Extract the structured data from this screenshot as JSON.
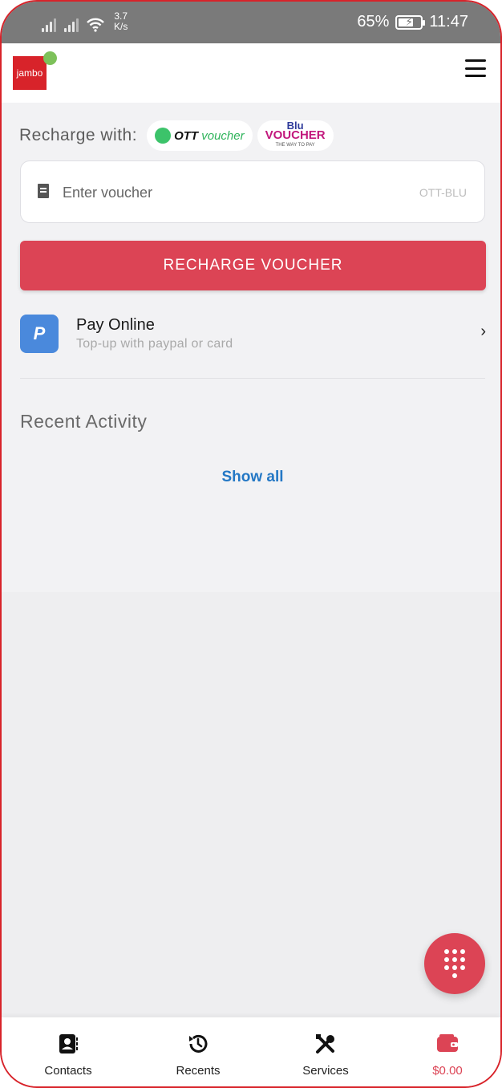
{
  "status_bar": {
    "speed_value": "3.7",
    "speed_unit": "K/s",
    "battery_percent": "65%",
    "time": "11:47"
  },
  "app": {
    "logo_text": "jambo",
    "menu_icon": "hamburger-icon"
  },
  "recharge": {
    "label": "Recharge with:",
    "providers": {
      "ott_brand": "OTT",
      "ott_suffix": "voucher",
      "blu_line1": "Blu",
      "blu_line2": "VOUCHER",
      "blu_tagline": "THE WAY TO PAY"
    },
    "voucher_placeholder": "Enter voucher",
    "voucher_value": "",
    "voucher_hint": "OTT-BLU",
    "button_label": "RECHARGE VOUCHER"
  },
  "pay_online": {
    "title": "Pay Online",
    "subtitle": "Top-up with paypal or card",
    "icon_letter": "P"
  },
  "recent_activity": {
    "title": "Recent Activity",
    "show_all": "Show all"
  },
  "bottom_nav": [
    {
      "label": "Contacts",
      "icon": "contacts-icon"
    },
    {
      "label": "Recents",
      "icon": "history-icon"
    },
    {
      "label": "Services",
      "icon": "tools-icon"
    },
    {
      "label": "$0.00",
      "icon": "wallet-icon"
    }
  ],
  "colors": {
    "accent": "#dc4455",
    "link": "#2478c5",
    "paypal": "#4a89dc",
    "border": "#d8232a"
  }
}
